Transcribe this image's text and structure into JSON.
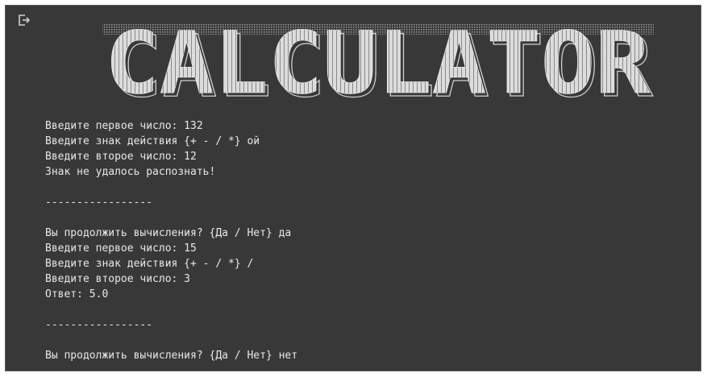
{
  "banner": {
    "text": "CALCULATOR"
  },
  "icons": {
    "exit": "exit-to-app-icon"
  },
  "output_lines": [
    "Введите первое число: 132",
    "Введите знак действия {+ - / *} ой",
    "Введите второе число: 12",
    "Знак не удалось распознать!",
    "",
    "-----------------",
    "",
    "Вы продолжить вычисления? {Да / Нет} да",
    "Введите первое число: 15",
    "Введите знак действия {+ - / *} /",
    "Введите второе число: 3",
    "Ответ: 5.0",
    "",
    "-----------------",
    "",
    "Вы продолжить вычисления? {Да / Нет} нет"
  ],
  "colors": {
    "cell_background": "#383838",
    "text": "#e8e8e8",
    "banner_fill": "#dcdcdc"
  }
}
